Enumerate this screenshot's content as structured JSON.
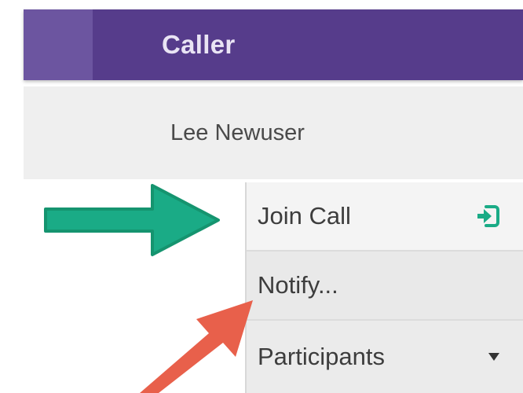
{
  "header": {
    "title": "Caller"
  },
  "user": {
    "name": "Lee Newuser"
  },
  "menu": {
    "items": [
      {
        "label": "Join Call",
        "icon": "join-call-icon"
      },
      {
        "label": "Notify..."
      },
      {
        "label": "Participants",
        "icon": "caret-down-icon"
      }
    ]
  },
  "colors": {
    "header_bg": "#563c8b",
    "header_tab": "#6c55a0",
    "accent_green": "#1aab86",
    "annotation_red": "#e8604b"
  },
  "annotations": {
    "green_arrow_icon": "right-arrow-icon",
    "red_arrow_icon": "up-right-arrow-icon"
  }
}
